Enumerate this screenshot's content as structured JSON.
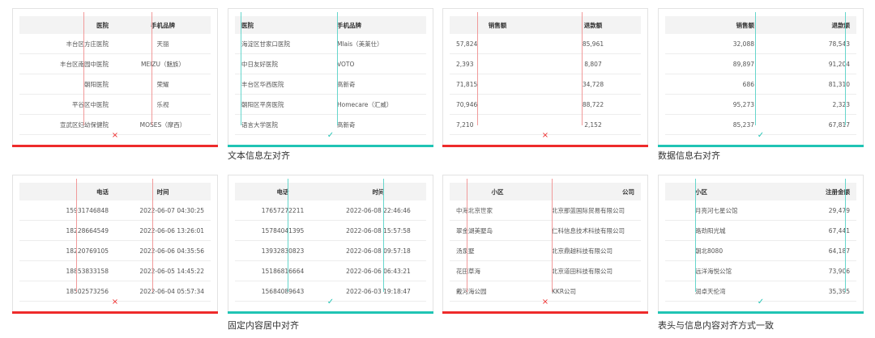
{
  "captions": {
    "text_left": "文本信息左对齐",
    "number_right": "数据信息右对齐",
    "fixed_center": "固定内容居中对齐",
    "header_match": "表头与信息内容对齐方式一致"
  },
  "marks": {
    "wrong": "×",
    "right": "✓"
  },
  "colors": {
    "wrong": "#ee2b2b",
    "right": "#20c4b4"
  },
  "text_bad": {
    "headers": [
      "医院",
      "手机品牌"
    ],
    "rows": [
      [
        "丰台区方庄医院",
        "天丽"
      ],
      [
        "丰台区南园中医院",
        "MEIZU（魅族）"
      ],
      [
        "朝阳医院",
        "荣耀"
      ],
      [
        "平谷区中医院",
        "乐视"
      ],
      [
        "宣武区妇幼保健院",
        "MOSES（摩西）"
      ]
    ]
  },
  "text_good": {
    "headers": [
      "医院",
      "手机品牌"
    ],
    "rows": [
      [
        "海淀区甘家口医院",
        "Mlais（美莱仕）"
      ],
      [
        "中日友好医院",
        "VOTO"
      ],
      [
        "丰台区华西医院",
        "高新奇"
      ],
      [
        "朝阳区平房医院",
        "Homecare（汇威）"
      ],
      [
        "语言大学医院",
        "高新奇"
      ]
    ]
  },
  "num_bad": {
    "headers": [
      "销售额",
      "退款额"
    ],
    "rows": [
      [
        "57,824",
        "85,961"
      ],
      [
        "2,393",
        "8,807"
      ],
      [
        "71,815",
        "34,728"
      ],
      [
        "70,946",
        "88,722"
      ],
      [
        "7,210",
        "2,152"
      ]
    ]
  },
  "num_good": {
    "headers": [
      "销售额",
      "退款额"
    ],
    "rows": [
      [
        "32,088",
        "78,543"
      ],
      [
        "89,897",
        "91,204"
      ],
      [
        "686",
        "81,310"
      ],
      [
        "95,273",
        "2,323"
      ],
      [
        "85,237",
        "67,817"
      ]
    ]
  },
  "fix_bad": {
    "headers": [
      "电话",
      "时间"
    ],
    "rows": [
      [
        "15931746848",
        "2022-06-07 04:30:25"
      ],
      [
        "18228664549",
        "2022-06-06 13:26:01"
      ],
      [
        "18220769105",
        "2022-06-06 04:35:56"
      ],
      [
        "18853833158",
        "2022-06-05 14:45:22"
      ],
      [
        "18502573256",
        "2022-06-04 05:57:34"
      ]
    ]
  },
  "fix_good": {
    "headers": [
      "电话",
      "时间"
    ],
    "rows": [
      [
        "17657272211",
        "2022-06-08 22:46:46"
      ],
      [
        "15784041395",
        "2022-06-08 15:57:58"
      ],
      [
        "13932830823",
        "2022-06-08 09:57:18"
      ],
      [
        "15186816664",
        "2022-06-06 06:43:21"
      ],
      [
        "15684089643",
        "2022-06-03 19:18:47"
      ]
    ]
  },
  "head_bad": {
    "headers": [
      "小区",
      "公司"
    ],
    "rows": [
      [
        "中海北京世家",
        "北京那蓝国际贸易有限公司"
      ],
      [
        "翠金湖美墅岛",
        "仁科信息技术科技有限公司"
      ],
      [
        "汤泉墅",
        "北京鼎越科技有限公司"
      ],
      [
        "花田草海",
        "北京道田科技有限公司"
      ],
      [
        "戴河海公园",
        "KKR公司"
      ]
    ]
  },
  "head_good": {
    "headers": [
      "小区",
      "注册金额"
    ],
    "rows": [
      [
        "月亮河七星公馆",
        "29,479"
      ],
      [
        "路劲阳光城",
        "67,441"
      ],
      [
        "朝北8080",
        "64,187"
      ],
      [
        "远洋海悦公馆",
        "73,906"
      ],
      [
        "润卓天伦湾",
        "35,395"
      ]
    ]
  }
}
